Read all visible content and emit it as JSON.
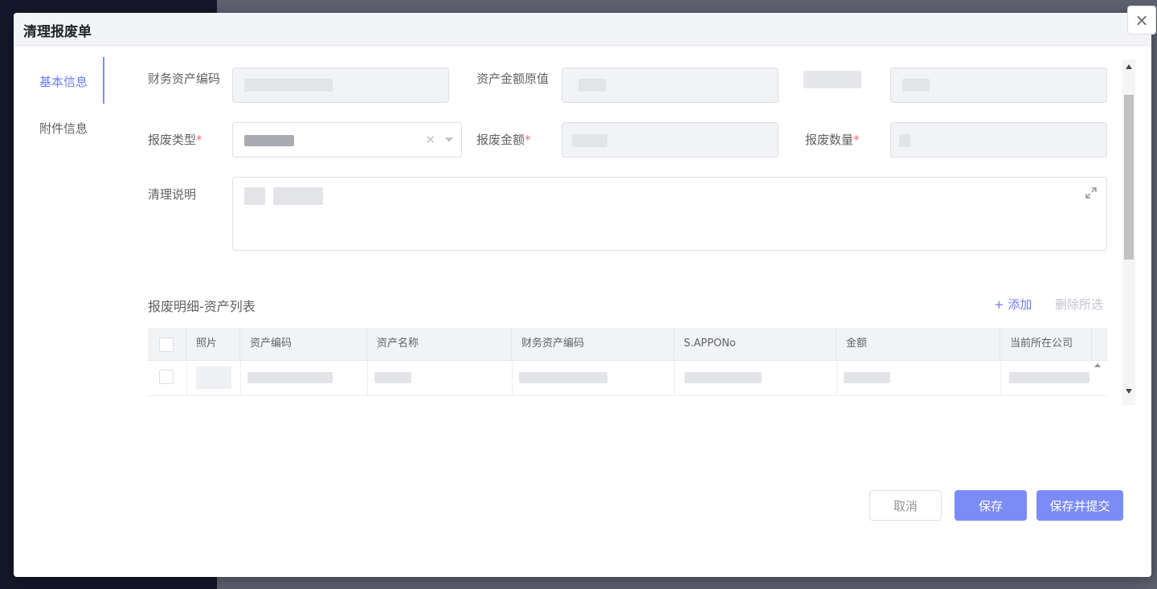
{
  "dialog": {
    "title": "清理报废单",
    "close_icon": "×"
  },
  "side_nav": {
    "items": [
      {
        "label": "基本信息",
        "active": true
      },
      {
        "label": "附件信息",
        "active": false
      }
    ]
  },
  "form": {
    "finance_asset_code": {
      "label": "财务资产编码"
    },
    "original_amount": {
      "label": "资产金额原值"
    },
    "scrap_type": {
      "label": "报废类型",
      "required_mark": "*"
    },
    "scrap_amount": {
      "label": "报废金额",
      "required_mark": "*"
    },
    "scrap_quantity": {
      "label": "报废数量",
      "required_mark": "*"
    },
    "clean_note": {
      "label": "清理说明"
    }
  },
  "detail_section": {
    "title": "报废明细-资产列表",
    "add_label": "+ 添加",
    "delete_label": "删除所选"
  },
  "table": {
    "columns": [
      "照片",
      "资产编码",
      "资产名称",
      "财务资产编码",
      "S.APPONo",
      "金额",
      "当前所在公司"
    ]
  },
  "footer": {
    "cancel_label": "取消",
    "save_label": "保存",
    "submit_label": "保存并提交"
  },
  "colors": {
    "accent": "#7c8cf7",
    "required": "#f56c6c"
  }
}
